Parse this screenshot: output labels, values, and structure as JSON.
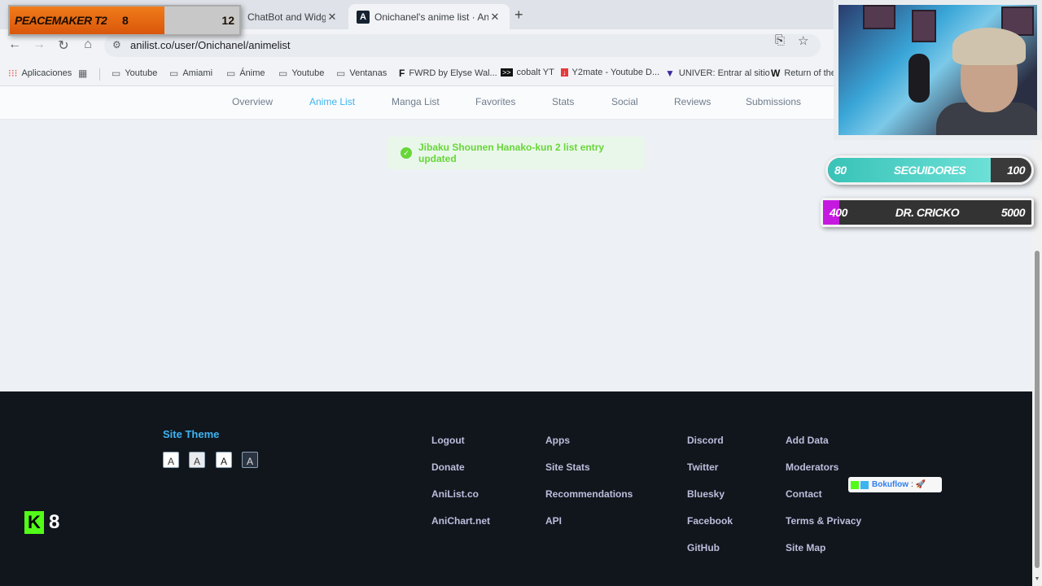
{
  "browser": {
    "tabs": [
      {
        "title": "ChatBot and Widgets",
        "active": false
      },
      {
        "title": "Onichanel's anime list · AniList",
        "active": true
      }
    ],
    "url": "anilist.co/user/Onichanel/animelist",
    "bookmarks": [
      {
        "label": "Aplicaciones",
        "icon": "apps-grid-icon"
      },
      {
        "label": "",
        "icon": "tab-groups-icon"
      },
      {
        "label": "Youtube",
        "icon": "folder-icon"
      },
      {
        "label": "Amiami",
        "icon": "folder-icon"
      },
      {
        "label": "Ánime",
        "icon": "folder-icon"
      },
      {
        "label": "Youtube",
        "icon": "folder-icon"
      },
      {
        "label": "Ventanas",
        "icon": "folder-icon"
      },
      {
        "label": "FWRD by Elyse Wal...",
        "icon": "fwrd-icon"
      },
      {
        "label": "cobalt YT",
        "icon": "cobalt-icon"
      },
      {
        "label": "Y2mate - Youtube D...",
        "icon": "y2mate-icon"
      },
      {
        "label": "UNIVER: Entrar al sitio",
        "icon": "univer-icon"
      },
      {
        "label": "Return of the",
        "icon": "wikipedia-icon"
      }
    ]
  },
  "site_nav": {
    "items": [
      {
        "label": "Overview"
      },
      {
        "label": "Anime List",
        "active": true
      },
      {
        "label": "Manga List"
      },
      {
        "label": "Favorites"
      },
      {
        "label": "Stats"
      },
      {
        "label": "Social"
      },
      {
        "label": "Reviews"
      },
      {
        "label": "Submissions"
      }
    ]
  },
  "toast": {
    "text": "Jibaku Shounen Hanako-kun 2 list entry updated"
  },
  "footer": {
    "theme_title": "Site Theme",
    "theme_buttons": [
      "A",
      "A",
      "A",
      "A"
    ],
    "col1": [
      "Logout",
      "Donate",
      "AniList.co",
      "AniChart.net"
    ],
    "col2": [
      "Apps",
      "Site Stats",
      "Recommendations",
      "API"
    ],
    "col3": [
      "Discord",
      "Twitter",
      "Bluesky",
      "Facebook",
      "GitHub"
    ],
    "col4": [
      "Add Data",
      "Moderators",
      "Contact",
      "Terms & Privacy",
      "Site Map"
    ]
  },
  "overlay": {
    "scoreboard": {
      "team": "PEACEMAKER T2",
      "left_value": "8",
      "right_value": "12"
    },
    "followers_goal": {
      "current": "80",
      "label": "SEGUIDORES",
      "target": "100",
      "progress": 0.8
    },
    "sub_goal": {
      "current": "400",
      "label": "DR. CRICKO",
      "target": "5000",
      "progress": 0.08
    },
    "kick": {
      "count": "8"
    },
    "chat": {
      "user": "Bokuflow",
      "message": ": 🚀"
    }
  },
  "colors": {
    "accent": "#3db4f2",
    "toast_green": "#68d639",
    "footer_bg": "#11161d",
    "kick_green": "#53fc18"
  }
}
